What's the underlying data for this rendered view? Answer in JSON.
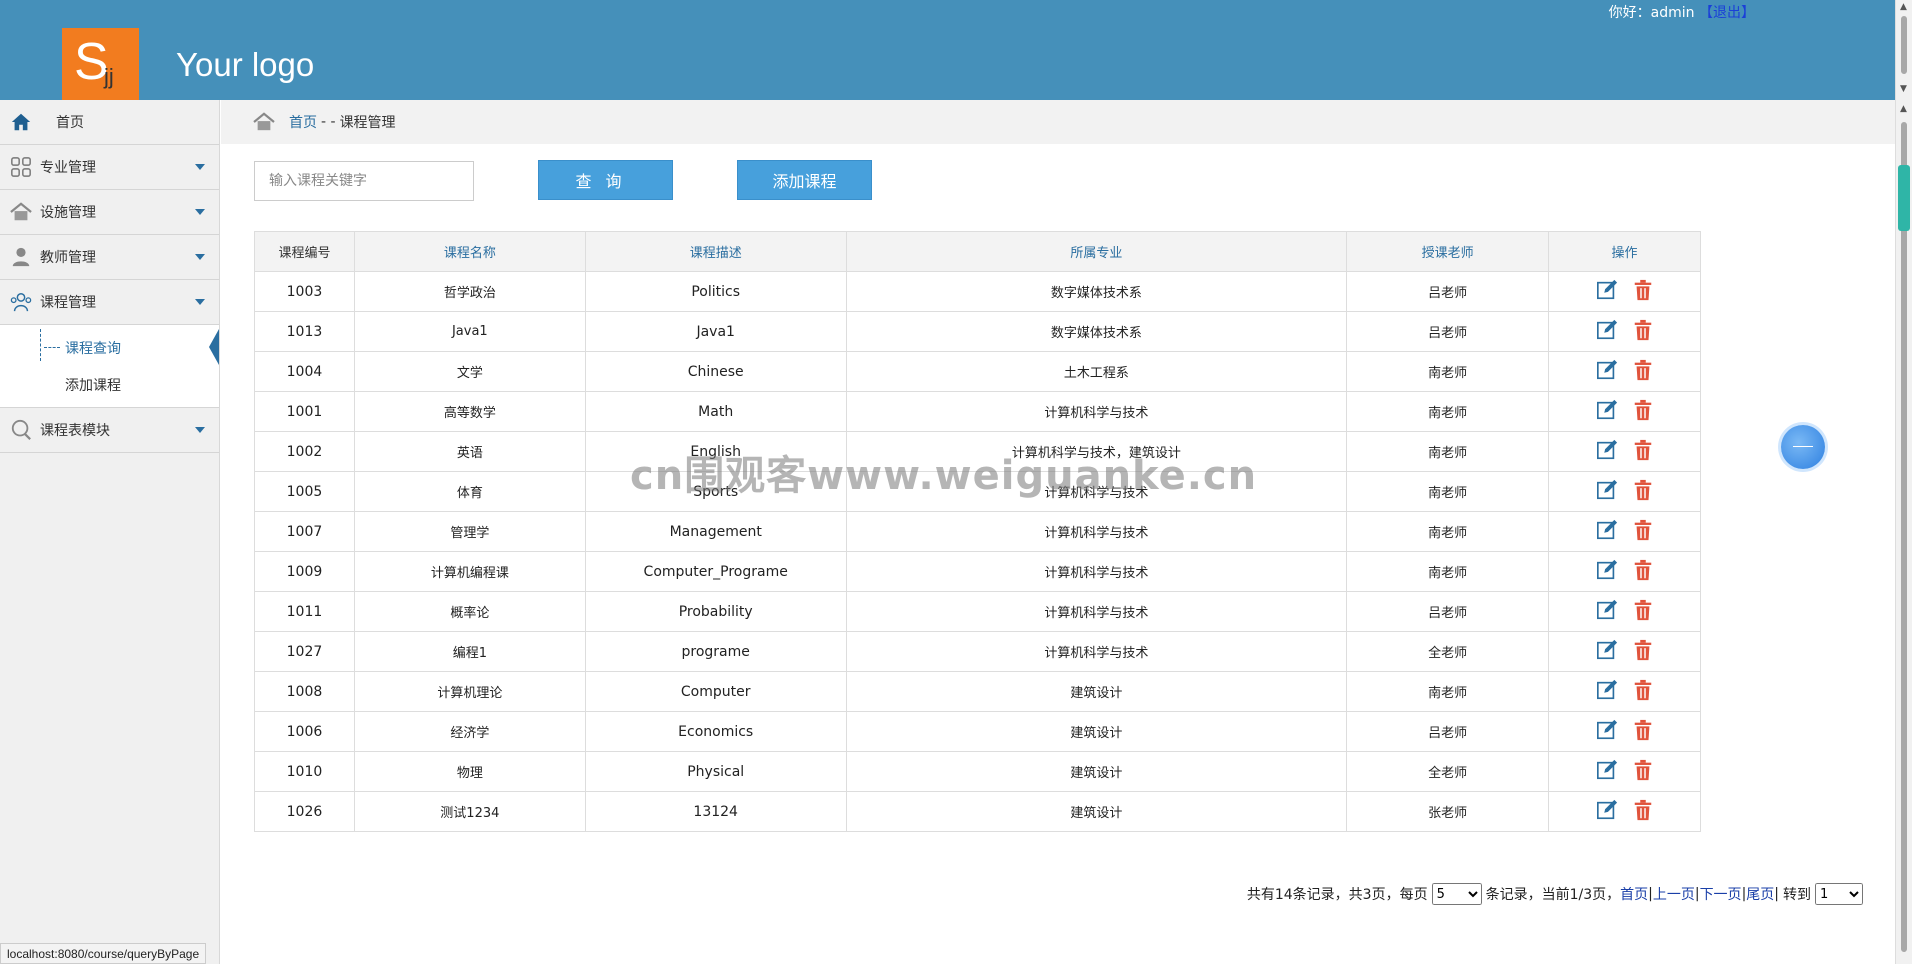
{
  "header": {
    "logo_letter": "S",
    "logo_sub": "jj",
    "logo_text": "Your logo",
    "greeting": "你好：admin",
    "logout_label": "【退出】"
  },
  "sidebar": {
    "home_label": "首页",
    "menus": [
      {
        "label": "专业管理",
        "icon": "grid-icon"
      },
      {
        "label": "设施管理",
        "icon": "house-icon"
      },
      {
        "label": "教师管理",
        "icon": "user-icon"
      },
      {
        "label": "课程管理",
        "icon": "people-icon"
      }
    ],
    "course_sub": [
      {
        "label": "课程查询",
        "active": true
      },
      {
        "label": "添加课程",
        "active": false
      }
    ],
    "schedule_label": "课程表模块"
  },
  "breadcrumb": {
    "home": "首页",
    "separator": "- -",
    "current": "课程管理"
  },
  "search": {
    "placeholder": "输入课程关键字",
    "query_label": "查询",
    "add_label": "添加课程"
  },
  "table": {
    "headers": [
      "课程编号",
      "课程名称",
      "课程描述",
      "所属专业",
      "授课老师",
      "操作"
    ],
    "rows": [
      [
        "1003",
        "哲学政治",
        "Politics",
        "数字媒体技术系",
        "吕老师"
      ],
      [
        "1013",
        "Java1",
        "Java1",
        "数字媒体技术系",
        "吕老师"
      ],
      [
        "1004",
        "文学",
        "Chinese",
        "土木工程系",
        "南老师"
      ],
      [
        "1001",
        "高等数学",
        "Math",
        "计算机科学与技术",
        "南老师"
      ],
      [
        "1002",
        "英语",
        "English",
        "计算机科学与技术，建筑设计",
        "南老师"
      ],
      [
        "1005",
        "体育",
        "Sports",
        "计算机科学与技术",
        "南老师"
      ],
      [
        "1007",
        "管理学",
        "Management",
        "计算机科学与技术",
        "南老师"
      ],
      [
        "1009",
        "计算机编程课",
        "Computer_Programe",
        "计算机科学与技术",
        "南老师"
      ],
      [
        "1011",
        "概率论",
        "Probability",
        "计算机科学与技术",
        "吕老师"
      ],
      [
        "1027",
        "编程1",
        "programe",
        "计算机科学与技术",
        "全老师"
      ],
      [
        "1008",
        "计算机理论",
        "Computer",
        "建筑设计",
        "南老师"
      ],
      [
        "1006",
        "经济学",
        "Economics",
        "建筑设计",
        "吕老师"
      ],
      [
        "1010",
        "物理",
        "Physical",
        "建筑设计",
        "全老师"
      ],
      [
        "1026",
        "测试1234",
        "13124",
        "建筑设计",
        "张老师"
      ]
    ]
  },
  "watermark": "cn围观客www.weiguanke.cn",
  "pager": {
    "summary": "共有14条记录，共3页，每页",
    "page_size": "5",
    "page_size_options": [
      "5"
    ],
    "records_text": "条记录，当前1/3页，",
    "first": "首页",
    "prev": "上一页",
    "next": "下一页",
    "last": "尾页",
    "goto": "转到",
    "page": "1",
    "page_options": [
      "1"
    ]
  },
  "status_url": "localhost:8080/course/queryByPage",
  "colors": {
    "header_bg": "#4590ba",
    "logo_bg": "#f27c1f",
    "button_bg": "#47a0dc",
    "accent": "#2a6ea0",
    "delete_red": "#e0533c"
  }
}
